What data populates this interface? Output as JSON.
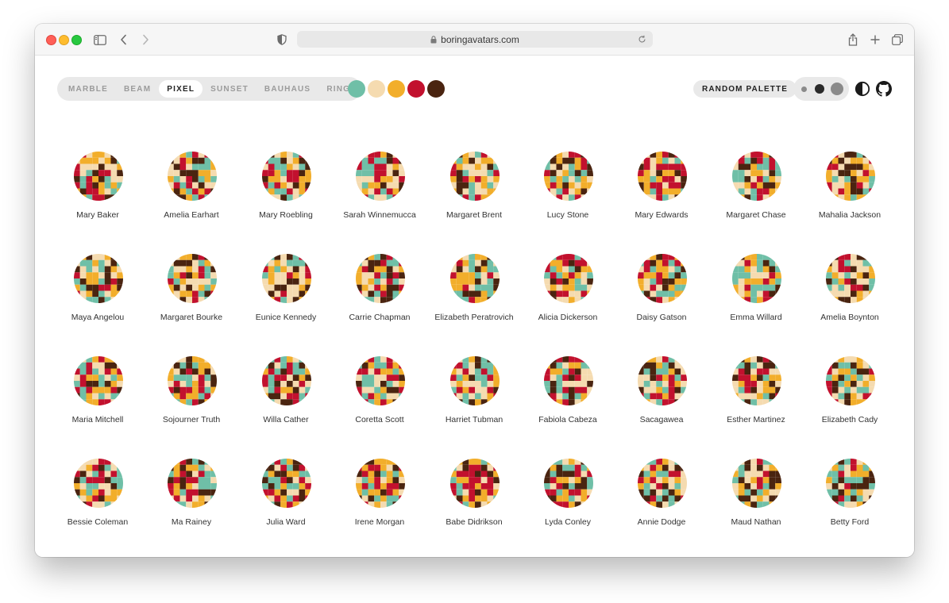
{
  "browser": {
    "url": "boringavatars.com"
  },
  "variants": [
    "MARBLE",
    "BEAM",
    "PIXEL",
    "SUNSET",
    "BAUHAUS",
    "RING"
  ],
  "active_variant": "PIXEL",
  "palette": [
    "#6fbfa7",
    "#f5dbb0",
    "#f2ae2b",
    "#c2112e",
    "#4a2410"
  ],
  "random_palette_label": "RANDOM PALETTE",
  "sizes": [
    "small",
    "medium",
    "large"
  ],
  "active_size": "medium",
  "icons": {
    "sidebar": "sidebar-icon",
    "back": "chevron-left-icon",
    "forward": "chevron-right-icon",
    "privacy": "shield-icon",
    "lock": "lock-icon",
    "reload": "reload-icon",
    "share": "share-icon",
    "new_tab": "plus-icon",
    "tabs": "tabs-overview-icon",
    "theme": "contrast-icon",
    "github": "github-icon"
  },
  "names": [
    "Mary Baker",
    "Amelia Earhart",
    "Mary Roebling",
    "Sarah Winnemucca",
    "Margaret Brent",
    "Lucy Stone",
    "Mary Edwards",
    "Margaret Chase",
    "Mahalia Jackson",
    "Maya Angelou",
    "Margaret Bourke",
    "Eunice Kennedy",
    "Carrie Chapman",
    "Elizabeth Peratrovich",
    "Alicia Dickerson",
    "Daisy Gatson",
    "Emma Willard",
    "Amelia Boynton",
    "Maria Mitchell",
    "Sojourner Truth",
    "Willa Cather",
    "Coretta Scott",
    "Harriet Tubman",
    "Fabiola Cabeza",
    "Sacagawea",
    "Esther Martinez",
    "Elizabeth Cady",
    "Bessie Coleman",
    "Ma Rainey",
    "Julia Ward",
    "Irene Morgan",
    "Babe Didrikson",
    "Lyda Conley",
    "Annie Dodge",
    "Maud Nathan",
    "Betty Ford"
  ]
}
